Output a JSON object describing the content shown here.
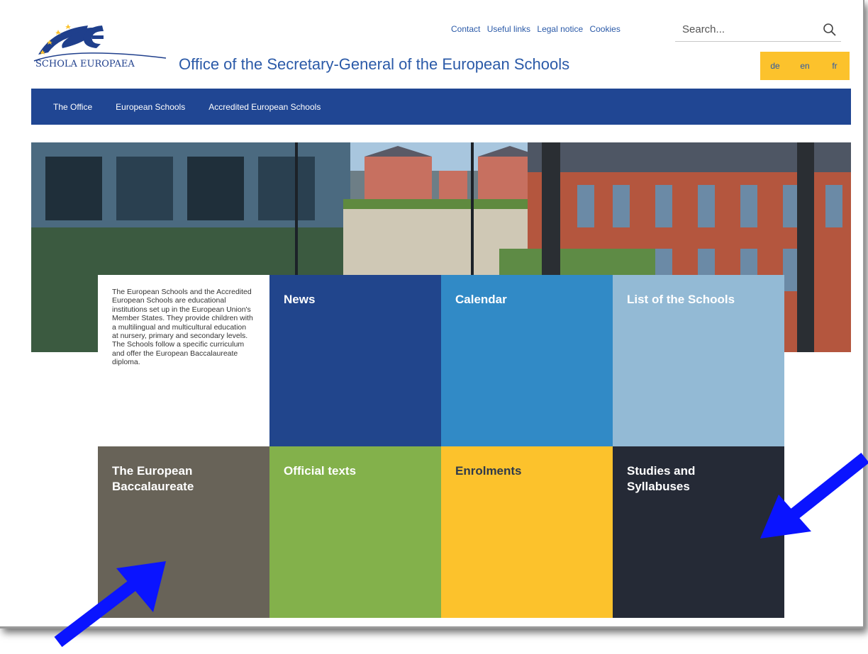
{
  "header": {
    "logo_text": "SCHOLA EUROPAEA",
    "site_title": "Office of the Secretary-General of the European Schools",
    "top_links": [
      "Contact",
      "Useful links",
      "Legal notice",
      "Cookies"
    ],
    "search_placeholder": "Search...",
    "languages": [
      "de",
      "en",
      "fr"
    ]
  },
  "nav": {
    "items": [
      "The Office",
      "European Schools",
      "Accredited European Schools"
    ]
  },
  "intro": {
    "text": "The European Schools and the Accredited European Schools are educational institutions set up in the European Union's Member States. They provide children with a multilingual and multicultural education at nursery, primary and secondary levels. The Schools follow a specific curriculum and offer the European Baccalaureate diploma."
  },
  "tiles": [
    {
      "label": "News",
      "color": "#21458c"
    },
    {
      "label": "Calendar",
      "color": "#318ac6"
    },
    {
      "label": "List of the Schools",
      "color": "#93bad5"
    },
    {
      "label": "The European Baccalaureate",
      "color": "#686358"
    },
    {
      "label": "Official texts",
      "color": "#83b14b"
    },
    {
      "label": "Enrolments",
      "color": "#fcc22c"
    },
    {
      "label": "Studies and Syllabuses",
      "color": "#252a36"
    }
  ],
  "colors": {
    "brand_blue": "#204693",
    "link_blue": "#2b5aa8",
    "lang_yellow": "#fcc22c",
    "annotation_arrow": "#0a14ff"
  },
  "icons": {
    "search": "search-icon",
    "logo": "schola-europaea-logo-icon",
    "annotation": "arrow-icon"
  }
}
